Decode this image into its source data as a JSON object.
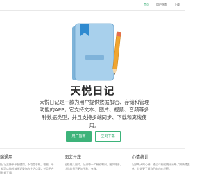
{
  "nav": {
    "items": [
      {
        "label": "首页",
        "active": true
      },
      {
        "label": "用户指南",
        "active": false
      },
      {
        "label": "下载",
        "active": false
      }
    ]
  },
  "hero": {
    "title": "天悦日记",
    "description": "天悦日记是一款为用户提供数据加密、存储和管理功能的APP。它支持文本、图片、视频、音频等多种数据类型，并且支持多端同步、下载和离线使用。",
    "primary_button": "用户指南",
    "secondary_button": "立刻下载"
  },
  "features": [
    {
      "title": "多端通用",
      "text": "天悦日记支持多平台使用，不管是手机、电脑、平板，都可以随时随地记录你的生活点滴，并且平台之间数据互通。"
    },
    {
      "title": "图文并茂",
      "text": "轻松插入图片，记录每一个精彩瞬间，图文结合，让你的日记更加生动、有趣。"
    },
    {
      "title": "心情统计",
      "text": "记录每天的心情，通过可视化统计清晰了解情绪变化，让你更了解自己的内心世界。"
    }
  ],
  "colors": {
    "accent": "#3db37a",
    "book_cover": "#a8d0ec",
    "bookmark": "#2f8ad0",
    "pencil": "#f0a531"
  }
}
